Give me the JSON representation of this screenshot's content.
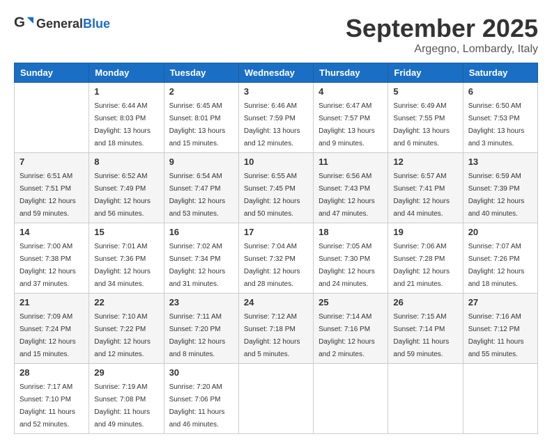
{
  "logo": {
    "general": "General",
    "blue": "Blue"
  },
  "header": {
    "month": "September 2025",
    "location": "Argegno, Lombardy, Italy"
  },
  "weekdays": [
    "Sunday",
    "Monday",
    "Tuesday",
    "Wednesday",
    "Thursday",
    "Friday",
    "Saturday"
  ],
  "weeks": [
    [
      {
        "day": "",
        "info": ""
      },
      {
        "day": "1",
        "info": "Sunrise: 6:44 AM\nSunset: 8:03 PM\nDaylight: 13 hours\nand 18 minutes."
      },
      {
        "day": "2",
        "info": "Sunrise: 6:45 AM\nSunset: 8:01 PM\nDaylight: 13 hours\nand 15 minutes."
      },
      {
        "day": "3",
        "info": "Sunrise: 6:46 AM\nSunset: 7:59 PM\nDaylight: 13 hours\nand 12 minutes."
      },
      {
        "day": "4",
        "info": "Sunrise: 6:47 AM\nSunset: 7:57 PM\nDaylight: 13 hours\nand 9 minutes."
      },
      {
        "day": "5",
        "info": "Sunrise: 6:49 AM\nSunset: 7:55 PM\nDaylight: 13 hours\nand 6 minutes."
      },
      {
        "day": "6",
        "info": "Sunrise: 6:50 AM\nSunset: 7:53 PM\nDaylight: 13 hours\nand 3 minutes."
      }
    ],
    [
      {
        "day": "7",
        "info": "Sunrise: 6:51 AM\nSunset: 7:51 PM\nDaylight: 12 hours\nand 59 minutes."
      },
      {
        "day": "8",
        "info": "Sunrise: 6:52 AM\nSunset: 7:49 PM\nDaylight: 12 hours\nand 56 minutes."
      },
      {
        "day": "9",
        "info": "Sunrise: 6:54 AM\nSunset: 7:47 PM\nDaylight: 12 hours\nand 53 minutes."
      },
      {
        "day": "10",
        "info": "Sunrise: 6:55 AM\nSunset: 7:45 PM\nDaylight: 12 hours\nand 50 minutes."
      },
      {
        "day": "11",
        "info": "Sunrise: 6:56 AM\nSunset: 7:43 PM\nDaylight: 12 hours\nand 47 minutes."
      },
      {
        "day": "12",
        "info": "Sunrise: 6:57 AM\nSunset: 7:41 PM\nDaylight: 12 hours\nand 44 minutes."
      },
      {
        "day": "13",
        "info": "Sunrise: 6:59 AM\nSunset: 7:39 PM\nDaylight: 12 hours\nand 40 minutes."
      }
    ],
    [
      {
        "day": "14",
        "info": "Sunrise: 7:00 AM\nSunset: 7:38 PM\nDaylight: 12 hours\nand 37 minutes."
      },
      {
        "day": "15",
        "info": "Sunrise: 7:01 AM\nSunset: 7:36 PM\nDaylight: 12 hours\nand 34 minutes."
      },
      {
        "day": "16",
        "info": "Sunrise: 7:02 AM\nSunset: 7:34 PM\nDaylight: 12 hours\nand 31 minutes."
      },
      {
        "day": "17",
        "info": "Sunrise: 7:04 AM\nSunset: 7:32 PM\nDaylight: 12 hours\nand 28 minutes."
      },
      {
        "day": "18",
        "info": "Sunrise: 7:05 AM\nSunset: 7:30 PM\nDaylight: 12 hours\nand 24 minutes."
      },
      {
        "day": "19",
        "info": "Sunrise: 7:06 AM\nSunset: 7:28 PM\nDaylight: 12 hours\nand 21 minutes."
      },
      {
        "day": "20",
        "info": "Sunrise: 7:07 AM\nSunset: 7:26 PM\nDaylight: 12 hours\nand 18 minutes."
      }
    ],
    [
      {
        "day": "21",
        "info": "Sunrise: 7:09 AM\nSunset: 7:24 PM\nDaylight: 12 hours\nand 15 minutes."
      },
      {
        "day": "22",
        "info": "Sunrise: 7:10 AM\nSunset: 7:22 PM\nDaylight: 12 hours\nand 12 minutes."
      },
      {
        "day": "23",
        "info": "Sunrise: 7:11 AM\nSunset: 7:20 PM\nDaylight: 12 hours\nand 8 minutes."
      },
      {
        "day": "24",
        "info": "Sunrise: 7:12 AM\nSunset: 7:18 PM\nDaylight: 12 hours\nand 5 minutes."
      },
      {
        "day": "25",
        "info": "Sunrise: 7:14 AM\nSunset: 7:16 PM\nDaylight: 12 hours\nand 2 minutes."
      },
      {
        "day": "26",
        "info": "Sunrise: 7:15 AM\nSunset: 7:14 PM\nDaylight: 11 hours\nand 59 minutes."
      },
      {
        "day": "27",
        "info": "Sunrise: 7:16 AM\nSunset: 7:12 PM\nDaylight: 11 hours\nand 55 minutes."
      }
    ],
    [
      {
        "day": "28",
        "info": "Sunrise: 7:17 AM\nSunset: 7:10 PM\nDaylight: 11 hours\nand 52 minutes."
      },
      {
        "day": "29",
        "info": "Sunrise: 7:19 AM\nSunset: 7:08 PM\nDaylight: 11 hours\nand 49 minutes."
      },
      {
        "day": "30",
        "info": "Sunrise: 7:20 AM\nSunset: 7:06 PM\nDaylight: 11 hours\nand 46 minutes."
      },
      {
        "day": "",
        "info": ""
      },
      {
        "day": "",
        "info": ""
      },
      {
        "day": "",
        "info": ""
      },
      {
        "day": "",
        "info": ""
      }
    ]
  ]
}
